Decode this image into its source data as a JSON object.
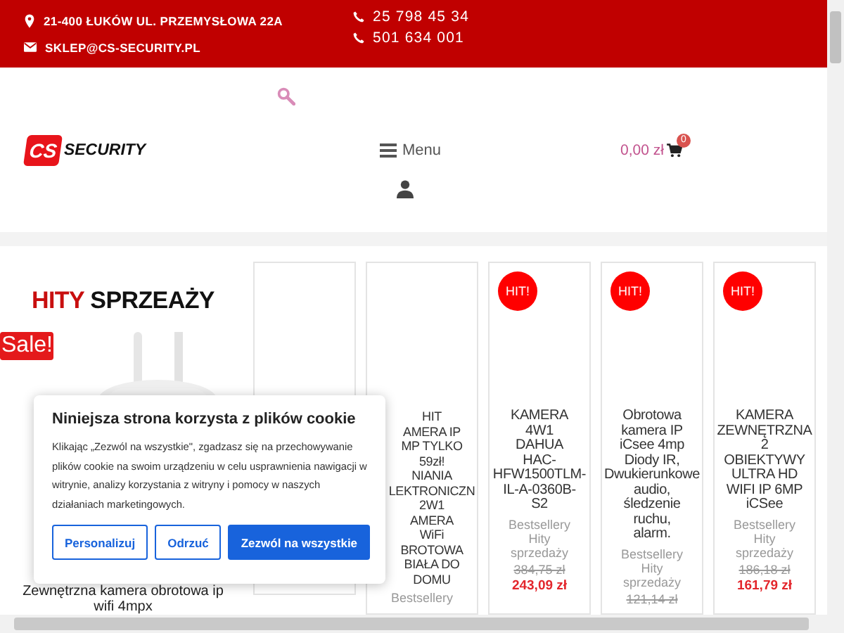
{
  "top_bar": {
    "address": "21-400 ŁUKÓW UL. PRZEMYSŁOWA 22A",
    "email": "SKLEP@CS-SECURITY.PL",
    "phones": [
      "25 798 45 34",
      "501 634 001"
    ]
  },
  "header": {
    "logo": {
      "mark": "CS",
      "word": "SECURITY"
    },
    "menu_label": "Menu",
    "cart": {
      "total": "0,00 zł",
      "count": "0"
    }
  },
  "section": {
    "heading_red": "HITY",
    "heading_dark": "SPRZEAŻY"
  },
  "featured": {
    "badge": "Sale!",
    "kind": "picture",
    "title": "Zewnętrzna kamera obrotowa ip wifi 4mpx"
  },
  "products": [
    {
      "hit": false
    },
    {
      "hit": false,
      "title_lines": [
        "HIT",
        "AMERA IP",
        "MP TYLKO",
        "59zł!",
        "NIANIA",
        "LEKTRONICZN",
        "2W1",
        "AMERA",
        "WiFi",
        "BROTOWA",
        "BIAŁA DO",
        "DOMU"
      ],
      "categories": "Bestsellery"
    },
    {
      "hit": true,
      "badge": "HIT!",
      "title_lines": [
        "KAMERA",
        "4W1",
        "DAHUA",
        "HAC-",
        "HFW1500TLM-",
        "IL-A-0360B-",
        "S2"
      ],
      "categories": "Bestsellery Hity sprzedaży",
      "old_price": "384,75 zł",
      "price": "243,09 zł"
    },
    {
      "hit": true,
      "badge": "HIT!",
      "title_lines": [
        "Obrotowa",
        "kamera IP",
        "iCsee 4mp",
        "Diody IR,",
        "Dwukierunkowe",
        "audio,",
        "śledzenie",
        "ruchu,",
        "alarm."
      ],
      "categories": "Bestsellery Hity sprzedaży",
      "old_price": "121,14 zł"
    },
    {
      "hit": true,
      "badge": "HIT!",
      "title_lines": [
        "KAMERA",
        "ZEWNĘTRZNA",
        "2",
        "OBIEKTYWY",
        "ULTRA HD",
        "WIFI IP 6MP",
        "iCSee"
      ],
      "categories": "Bestsellery Hity sprzedaży",
      "old_price": "186,18 zł",
      "price": "161,79 zł"
    }
  ],
  "cookie_dialog": {
    "title": "Niniejsza strona korzysta z plików cookie",
    "text": "Klikając „Zezwól na wszystkie\", zgadzasz się na przechowywanie plików cookie na swoim urządzeniu w celu usprawnienia nawigacji w witrynie, analizy korzystania z witryny i pomocy w naszych działaniach marketingowych.",
    "buttons": [
      {
        "label": "Personalizuj",
        "kind": "outline"
      },
      {
        "label": "Odrzuć",
        "kind": "outline"
      },
      {
        "label": "Zezwól na wszystkie",
        "kind": "primary"
      }
    ]
  }
}
